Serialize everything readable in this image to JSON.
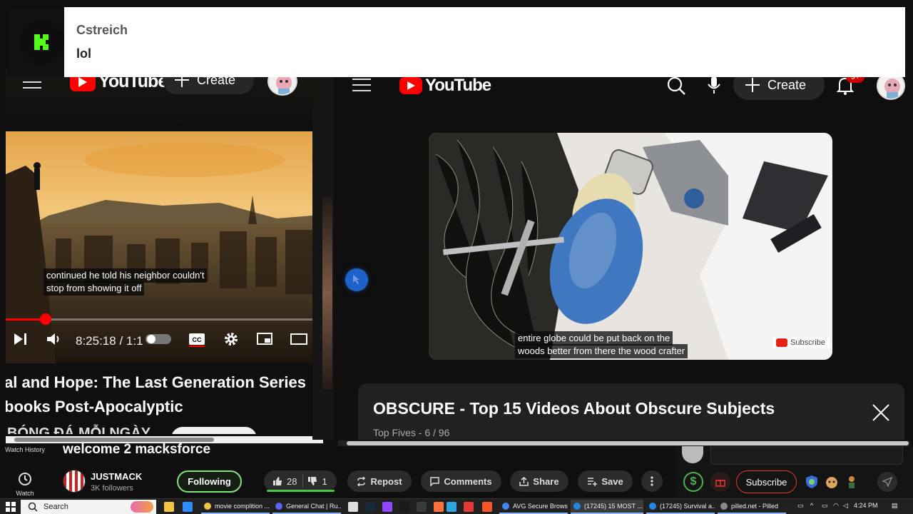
{
  "notification": {
    "sender": "Cstreich",
    "message": "lol"
  },
  "left_player": {
    "header": {
      "create_label": "Create",
      "logo_text": "YouTube"
    },
    "caption_line1": "continued he told his neighbor couldn't",
    "caption_line2": "stop from showing it off",
    "time_display": "8:25:18 / 1:1",
    "progress_fraction": 0.13,
    "title_line1": "al and Hope: The Last Generation Series",
    "title_line2": "books Post-Apocalyptic",
    "channel_partial": "BÓNG ĐÁ MỖI NGÀY"
  },
  "right_player": {
    "header": {
      "create_label": "Create",
      "logo_text": "YouTube",
      "notification_badge": "9+"
    },
    "caption_line1": "entire globe could be put back on the",
    "caption_line2": "woods better from there the wood crafter",
    "watermark_subscribe": "Subscribe",
    "playlist_title": "OBSCURE - Top 15 Videos About Obscure Subjects",
    "playlist_subtitle": "Top Fives - 6 / 96"
  },
  "side_nav": {
    "items": [
      {
        "label": "Watch History",
        "icon": "history-icon"
      },
      {
        "label": "Watch",
        "icon": "clock-icon"
      }
    ]
  },
  "stream_bar": {
    "title": "welcome 2 macksforce",
    "channel_name": "JUSTMACK",
    "followers": "3K followers",
    "following_label": "Following",
    "likes": "28",
    "dislikes": "1",
    "repost_label": "Repost",
    "comments_label": "Comments",
    "share_label": "Share",
    "save_label": "Save",
    "subscribe_label": "Subscribe"
  },
  "taskbar": {
    "search_placeholder": "Search",
    "apps": [
      {
        "label": "movie complition ...",
        "color": "#f0c34a"
      },
      {
        "label": "General Chat | Ru...",
        "color": "#5865f2"
      },
      {
        "label": "AVG Secure Brows...",
        "color": "#4285f4"
      },
      {
        "label": "(17245) 15 MOST ...",
        "color": "#1e88e5"
      },
      {
        "label": "(17245) Survival a...",
        "color": "#1e88e5"
      },
      {
        "label": "pilled.net - Pilled",
        "color": "#888888"
      }
    ],
    "time": "4:24 PM"
  },
  "colors": {
    "youtube_red": "#ff0000",
    "following_green": "#82e27c",
    "subscribe_red": "#e53935",
    "kick_green": "#53fc18"
  }
}
